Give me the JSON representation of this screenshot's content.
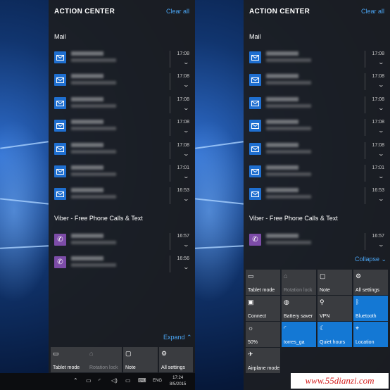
{
  "action_center": {
    "title": "ACTION CENTER",
    "clear_all": "Clear all"
  },
  "mail_group": "Mail",
  "viber_group": "Viber - Free Phone Calls & Text",
  "mail_times": [
    "17:08",
    "17:08",
    "17:08",
    "17:08",
    "17:08",
    "17:01",
    "16:53"
  ],
  "viber_times": [
    "16:57",
    "16:56"
  ],
  "left": {
    "expand": "Expand"
  },
  "right": {
    "collapse": "Collapse"
  },
  "tiles": {
    "tablet_mode": "Tablet mode",
    "rotation_lock": "Rotation lock",
    "note": "Note",
    "all_settings": "All settings",
    "connect": "Connect",
    "battery_saver": "Battery saver",
    "vpn": "VPN",
    "bluetooth": "Bluetooth",
    "brightness": "50%",
    "wifi": "torres_ga",
    "quiet_hours": "Quiet hours",
    "location": "Location",
    "airplane_mode": "Airplane mode"
  },
  "taskbar": {
    "lang": "ENG",
    "time": "17:24",
    "date": "8/5/2015"
  },
  "watermark": "www.55dianzi.com",
  "icons": {
    "mail": "mail-icon",
    "viber": "viber-icon",
    "colors": {
      "accent": "#1478d4",
      "link": "#4aa3f0",
      "viber": "#7d4ca8"
    }
  }
}
